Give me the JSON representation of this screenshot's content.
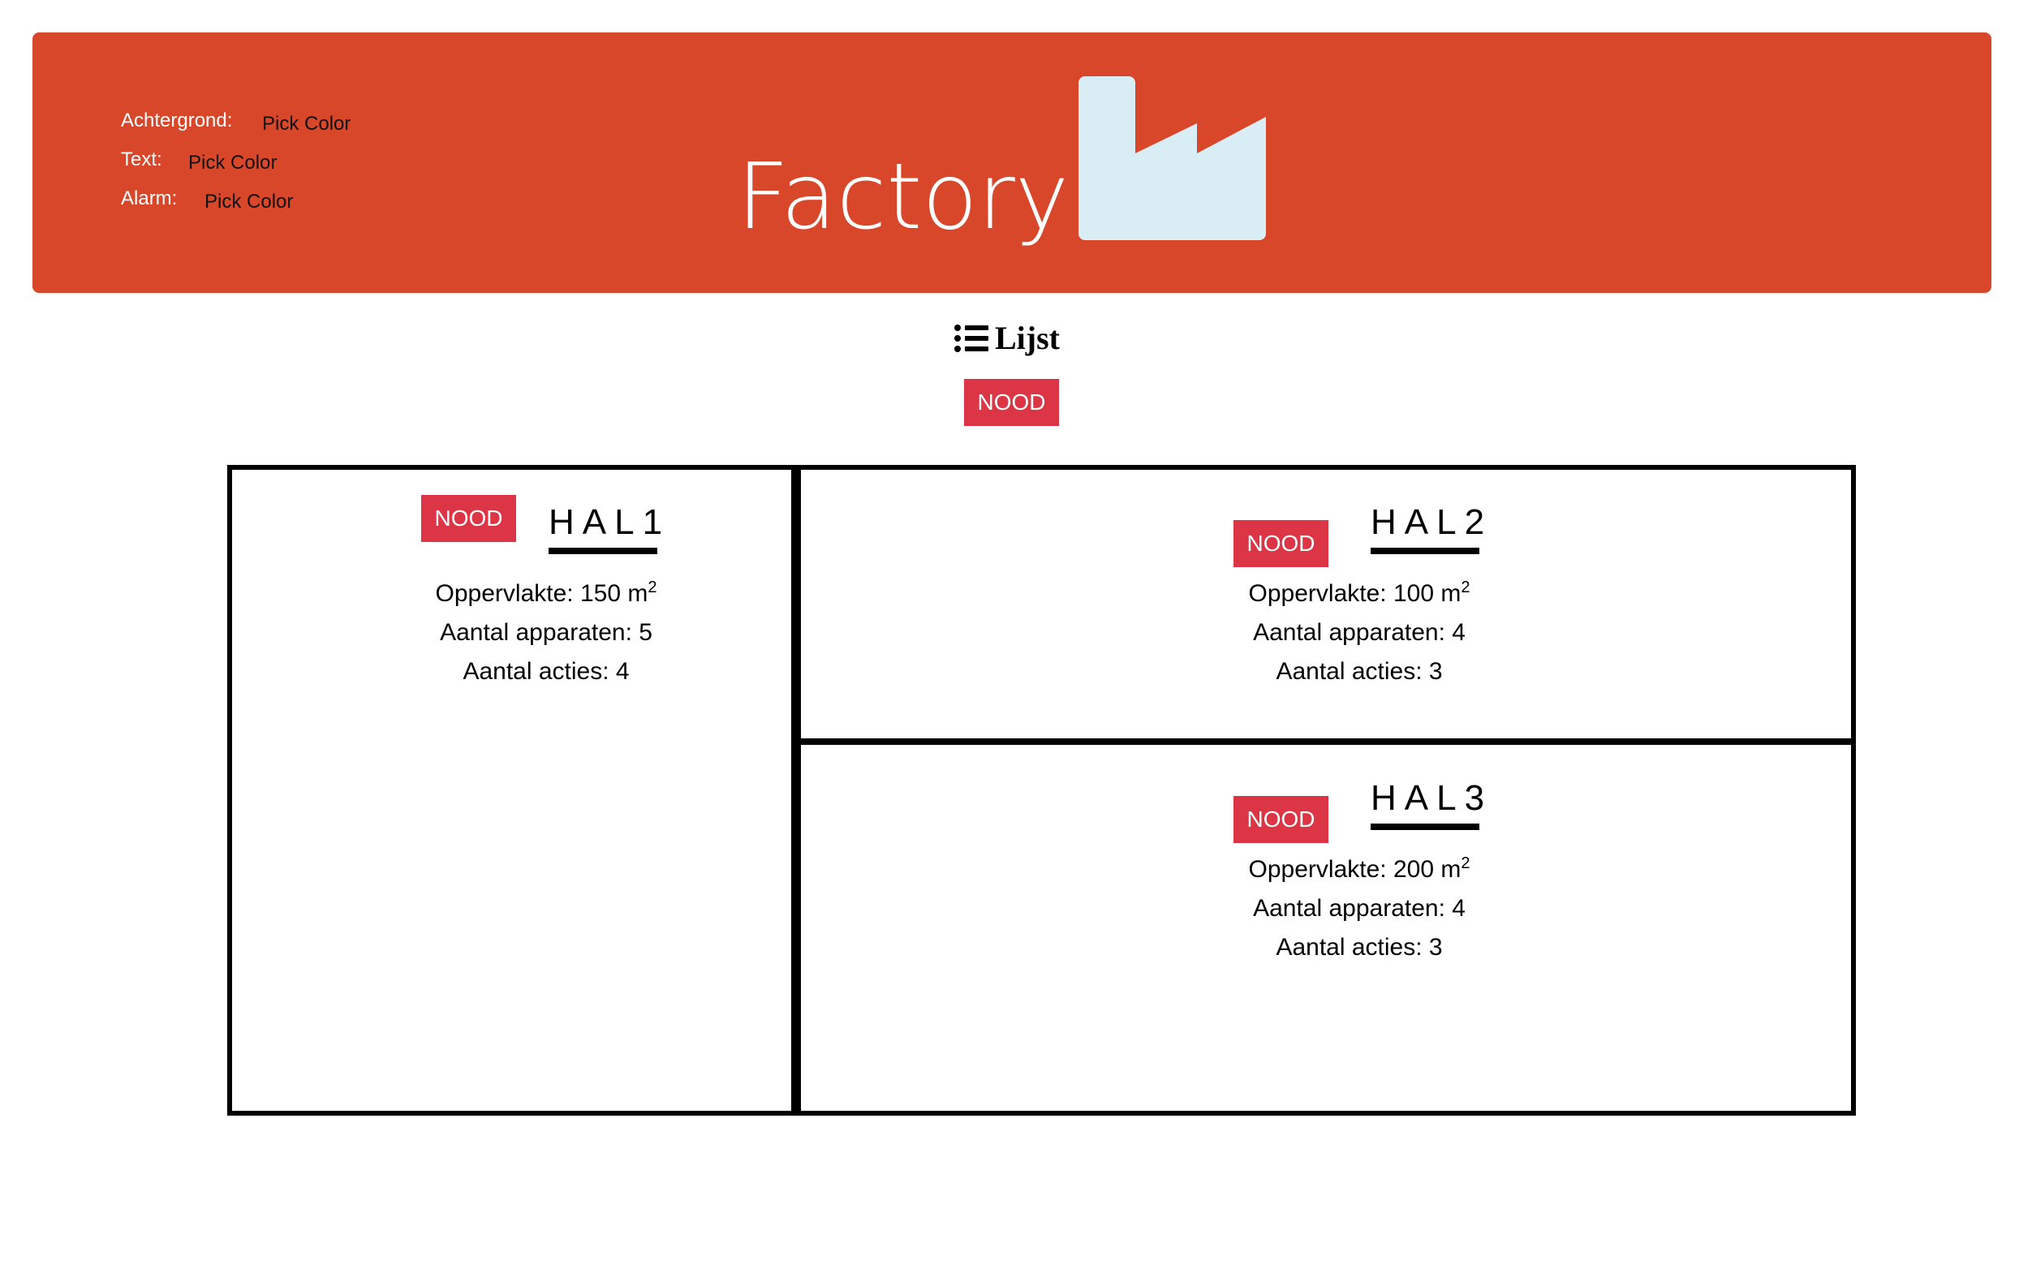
{
  "header": {
    "title": "Factory",
    "background_color": "#d9472b",
    "icon_color": "#d8edf4",
    "color_pickers": [
      {
        "label": "Achtergrond:",
        "action": "Pick Color"
      },
      {
        "label": "Text:",
        "action": "Pick Color"
      },
      {
        "label": "Alarm:",
        "action": "Pick Color"
      }
    ]
  },
  "nav": {
    "list_label": "Lijst",
    "list_icon": "list-icon"
  },
  "emergency": {
    "label": "NOOD",
    "color": "#dc3545"
  },
  "halls": [
    {
      "name": "HAL1",
      "emergency_label": "NOOD",
      "area_label": "Oppervlakte: 150 m",
      "area_unit_sup": "2",
      "devices": "Aantal apparaten: 5",
      "actions": "Aantal acties: 4"
    },
    {
      "name": "HAL2",
      "emergency_label": "NOOD",
      "area_label": "Oppervlakte: 100 m",
      "area_unit_sup": "2",
      "devices": "Aantal apparaten: 4",
      "actions": "Aantal acties: 3"
    },
    {
      "name": "HAL3",
      "emergency_label": "NOOD",
      "area_label": "Oppervlakte: 200 m",
      "area_unit_sup": "2",
      "devices": "Aantal apparaten: 4",
      "actions": "Aantal acties: 3"
    }
  ]
}
